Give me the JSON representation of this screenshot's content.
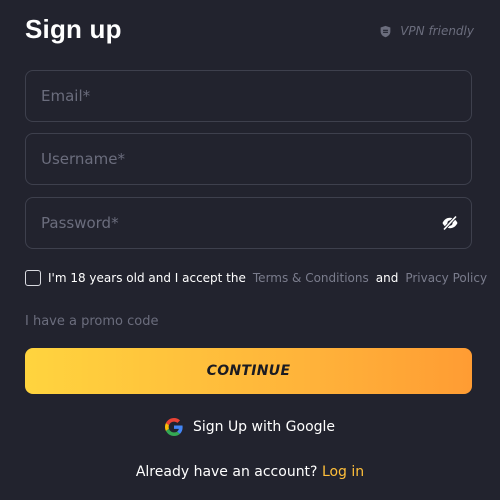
{
  "header": {
    "title": "Sign up",
    "vpn_label": "VPN friendly",
    "vpn_icon": "shield-icon"
  },
  "form": {
    "email": {
      "value": "",
      "placeholder": "Email*"
    },
    "username": {
      "value": "",
      "placeholder": "Username*"
    },
    "password": {
      "value": "",
      "placeholder": "Password*",
      "toggle_icon": "eye-slash-icon"
    },
    "terms": {
      "checked": false,
      "prefix": "I'm 18 years old and I accept the",
      "terms_link": "Terms & Conditions",
      "and": "and",
      "privacy_link": "Privacy Policy"
    },
    "promo_label": "I have a promo code",
    "continue_label": "CONTINUE"
  },
  "social": {
    "google_label": "Sign Up with Google",
    "google_icon": "google-icon"
  },
  "footer": {
    "prompt": "Already have an account?",
    "login_label": "Log in"
  },
  "colors": {
    "background": "#22232e",
    "field_border": "#3e404d",
    "placeholder": "#6b6d7d",
    "accent": "#ffbf3a",
    "button_gradient_start": "#ffd43e",
    "button_gradient_end": "#ff9c33"
  }
}
